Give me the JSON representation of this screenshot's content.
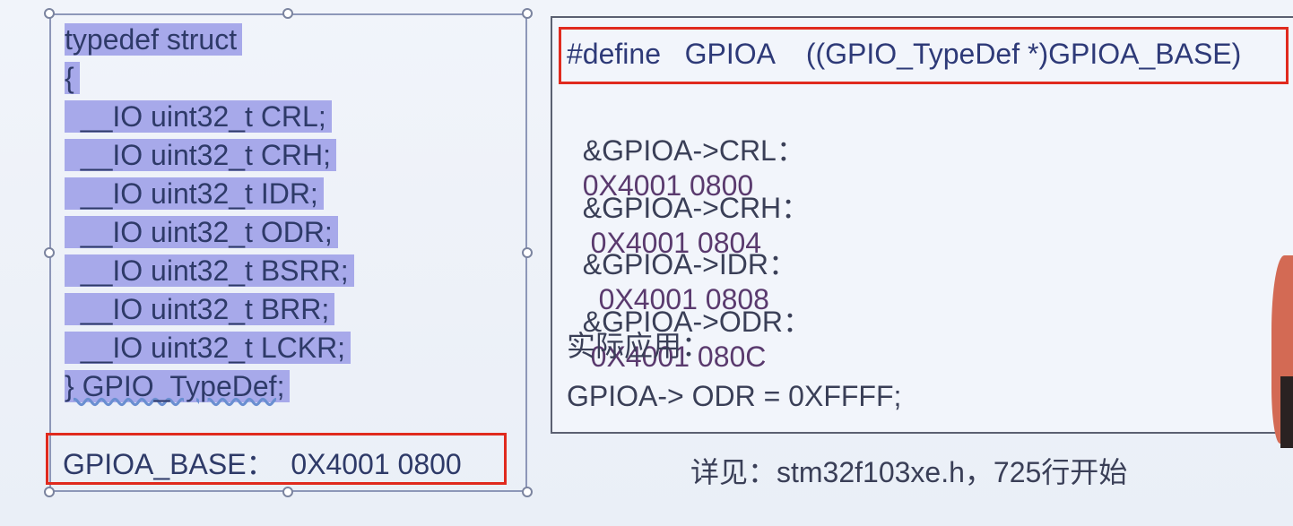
{
  "left_panel": {
    "code_lines": [
      "typedef struct",
      "{",
      "  __IO uint32_t CRL;",
      "  __IO uint32_t CRH;",
      "  __IO uint32_t IDR;",
      "  __IO uint32_t ODR;",
      "  __IO uint32_t BSRR;",
      "  __IO uint32_t BRR;",
      "  __IO uint32_t LCKR;",
      "} GPIO_TypeDef;"
    ],
    "base_label": "GPIOA_BASE：  0X4001 0800"
  },
  "right_panel": {
    "define_line": "#define   GPIOA    ((GPIO_TypeDef *)GPIOA_BASE)",
    "registers": [
      {
        "name": "&GPIOA->CRL：",
        "addr": "0X4001 0800"
      },
      {
        "name": "&GPIOA->CRH：",
        "addr": " 0X4001 0804"
      },
      {
        "name": "&GPIOA->IDR：",
        "addr": "  0X4001 0808"
      },
      {
        "name": "&GPIOA->ODR：",
        "addr": " 0X4001 080C"
      }
    ],
    "usage_label": "实际应用：",
    "usage_code": "GPIOA-> ODR = 0XFFFF;"
  },
  "caption": "详见：stm32f103xe.h，725行开始",
  "colors": {
    "highlight": "#a7a9ea",
    "red_box": "#e02a1e",
    "code_text": "#2e3a68"
  }
}
